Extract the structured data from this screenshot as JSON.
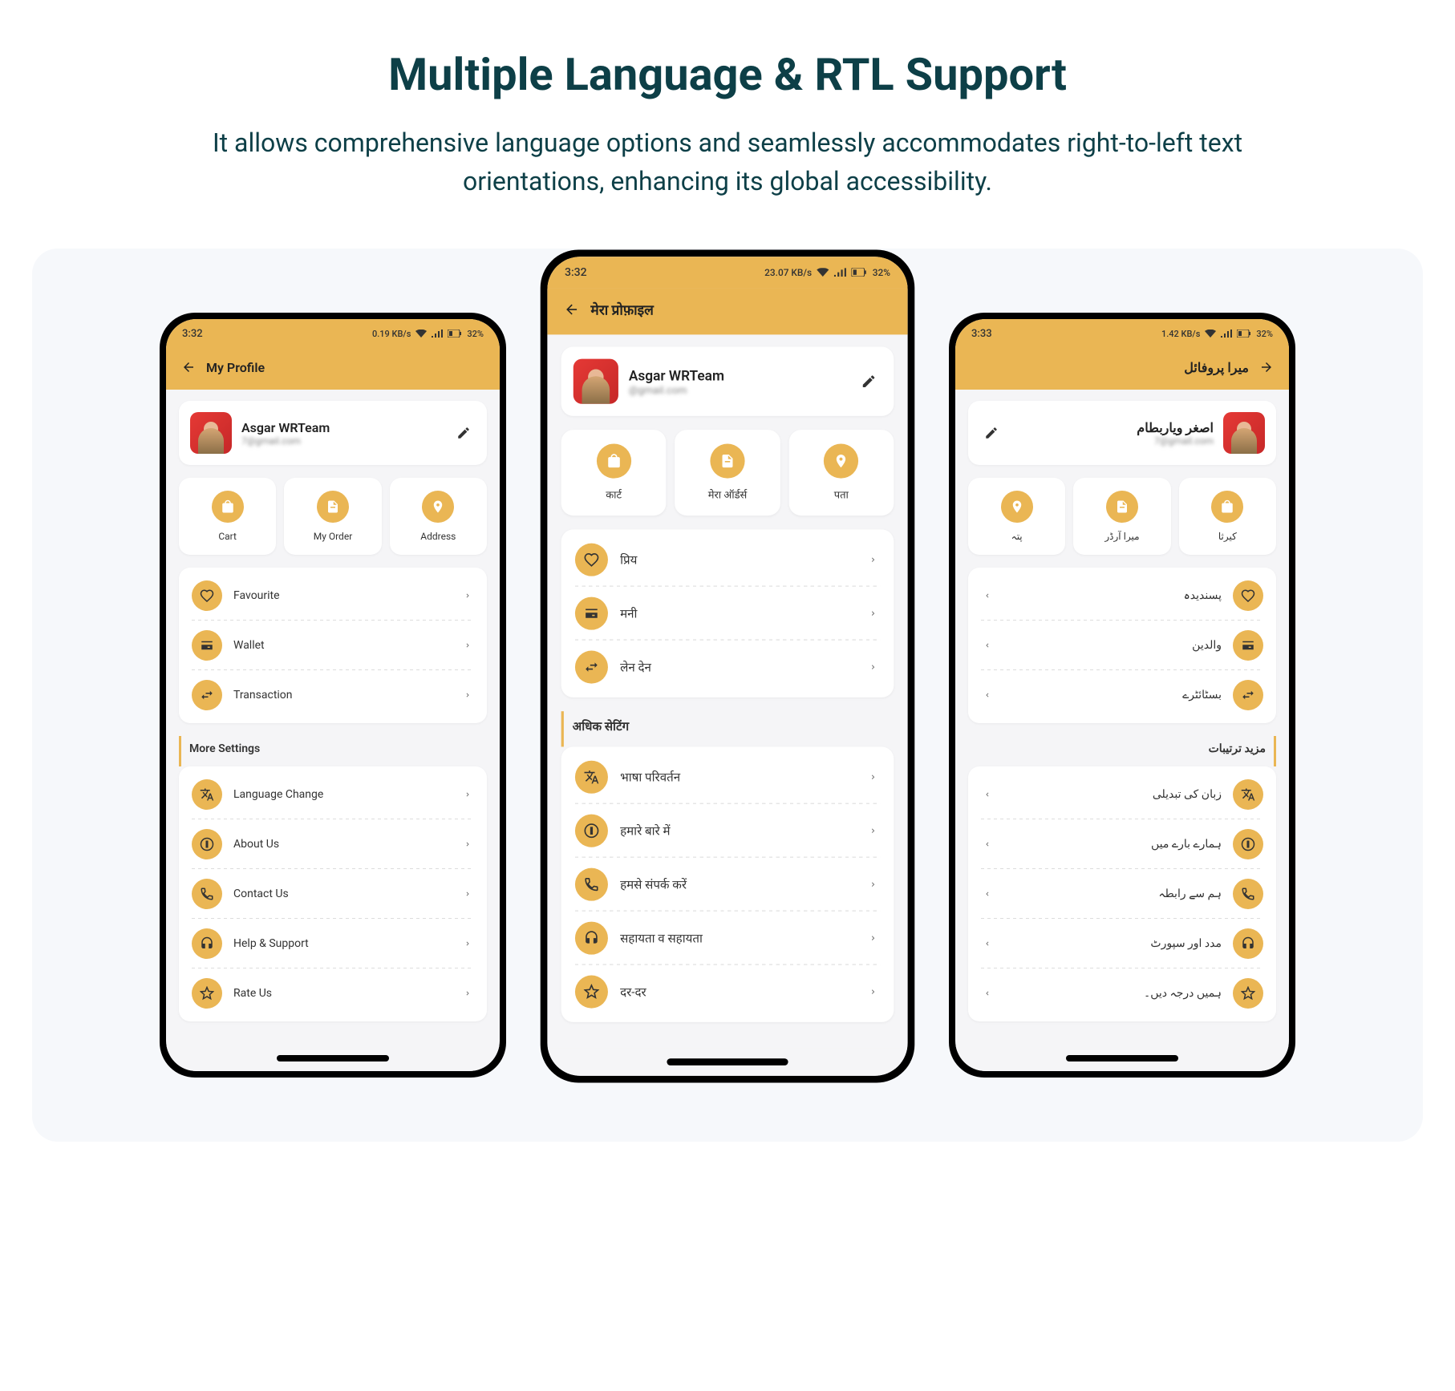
{
  "header": {
    "title": "Multiple Language & RTL Support",
    "subtitle": "It allows comprehensive language options and seamlessly accommodates right-to-left text orientations, enhancing its global accessibility."
  },
  "phones": {
    "en": {
      "status_time": "3:32",
      "status_data": "0.19 KB/s",
      "status_battery": "32%",
      "header": "My Profile",
      "profile_name": "Asgar WRTeam",
      "profile_email": "7@gmail.com",
      "actions": {
        "cart": "Cart",
        "order": "My Order",
        "address": "Address"
      },
      "menu1": {
        "favourite": "Favourite",
        "wallet": "Wallet",
        "transaction": "Transaction"
      },
      "section": "More Settings",
      "menu2": {
        "language": "Language Change",
        "about": "About Us",
        "contact": "Contact Us",
        "help": "Help & Support",
        "rate": "Rate Us"
      }
    },
    "hi": {
      "status_time": "3:32",
      "status_data": "23.07 KB/s",
      "status_battery": "32%",
      "header": "मेरा प्रोफ़ाइल",
      "profile_name": "Asgar WRTeam",
      "profile_email": "@gmail.com",
      "actions": {
        "cart": "कार्ट",
        "order": "मेरा ऑर्डर्स",
        "address": "पता"
      },
      "menu1": {
        "favourite": "प्रिय",
        "wallet": "मनी",
        "transaction": "लेन देन"
      },
      "section": "अधिक सेटिंग",
      "menu2": {
        "language": "भाषा परिवर्तन",
        "about": "हमारे बारे में",
        "contact": "हमसे संपर्क करें",
        "help": "सहायता व सहायता",
        "rate": "दर-दर"
      }
    },
    "ur": {
      "status_time": "3:33",
      "status_data": "1.42 KB/s",
      "status_battery": "32%",
      "header": "میرا پروفائل",
      "profile_name": "اصغر ویاربطام",
      "profile_email": "7@gmail.com",
      "actions": {
        "cart": "کیرثا",
        "order": "میرا آرڈر",
        "address": "پتہ"
      },
      "menu1": {
        "favourite": "پسندیدہ",
        "wallet": "والدین",
        "transaction": "بسٹائٹرے"
      },
      "section": "مزید ترتیبات",
      "menu2": {
        "language": "زبان کی تبدیلی",
        "about": "ہمارے بارے میں",
        "contact": "ہم سے رابطہ",
        "help": "مدد اور سپورٹ",
        "rate": "ہمیں درجہ دیں۔"
      }
    }
  }
}
